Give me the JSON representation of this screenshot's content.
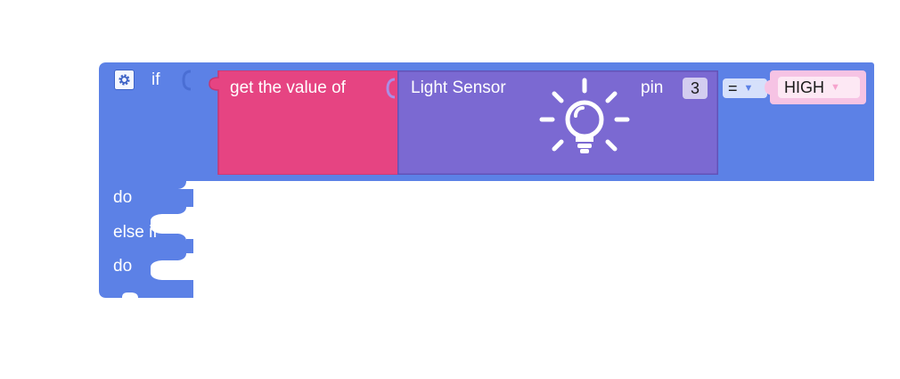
{
  "if_block": {
    "if_label": "if",
    "do_label": "do",
    "else_if_label": "else if",
    "do2_label": "do",
    "mutator_icon": "gear-icon",
    "color": "#5c81e6"
  },
  "get_value_block": {
    "label": "get the value of",
    "color": "#e64482"
  },
  "sensor_block": {
    "label": "Light Sensor",
    "pin_label": "pin",
    "pin_value": "3",
    "icon": "lightbulb-icon",
    "color": "#7b69d2"
  },
  "compare_block": {
    "operator": "=",
    "value": "HIGH",
    "color": "#f6c3e4"
  }
}
